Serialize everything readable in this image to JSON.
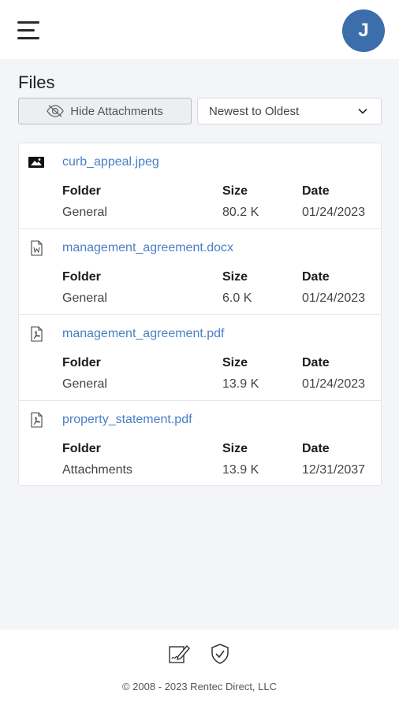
{
  "header": {
    "avatar_initial": "J"
  },
  "page": {
    "title": "Files"
  },
  "controls": {
    "hide_attachments_label": "Hide Attachments",
    "sort_selected": "Newest to Oldest"
  },
  "columns": {
    "folder": "Folder",
    "size": "Size",
    "date": "Date"
  },
  "files": [
    {
      "name": "curb_appeal.jpeg",
      "icon": "image-icon",
      "folder": "General",
      "size": "80.2 K",
      "date": "01/24/2023"
    },
    {
      "name": "management_agreement.docx",
      "icon": "word-doc-icon",
      "folder": "General",
      "size": "6.0 K",
      "date": "01/24/2023"
    },
    {
      "name": "management_agreement.pdf",
      "icon": "pdf-icon",
      "folder": "General",
      "size": "13.9 K",
      "date": "01/24/2023"
    },
    {
      "name": "property_statement.pdf",
      "icon": "pdf-icon",
      "folder": "Attachments",
      "size": "13.9 K",
      "date": "12/31/2037"
    }
  ],
  "footer": {
    "icons": [
      "sign-document-icon",
      "shield-check-icon"
    ],
    "copyright": "© 2008 - 2023 Rentec Direct, LLC"
  },
  "colors": {
    "accent": "#3b6eab",
    "link": "#4a7fc7",
    "background": "#f3f5f9"
  }
}
